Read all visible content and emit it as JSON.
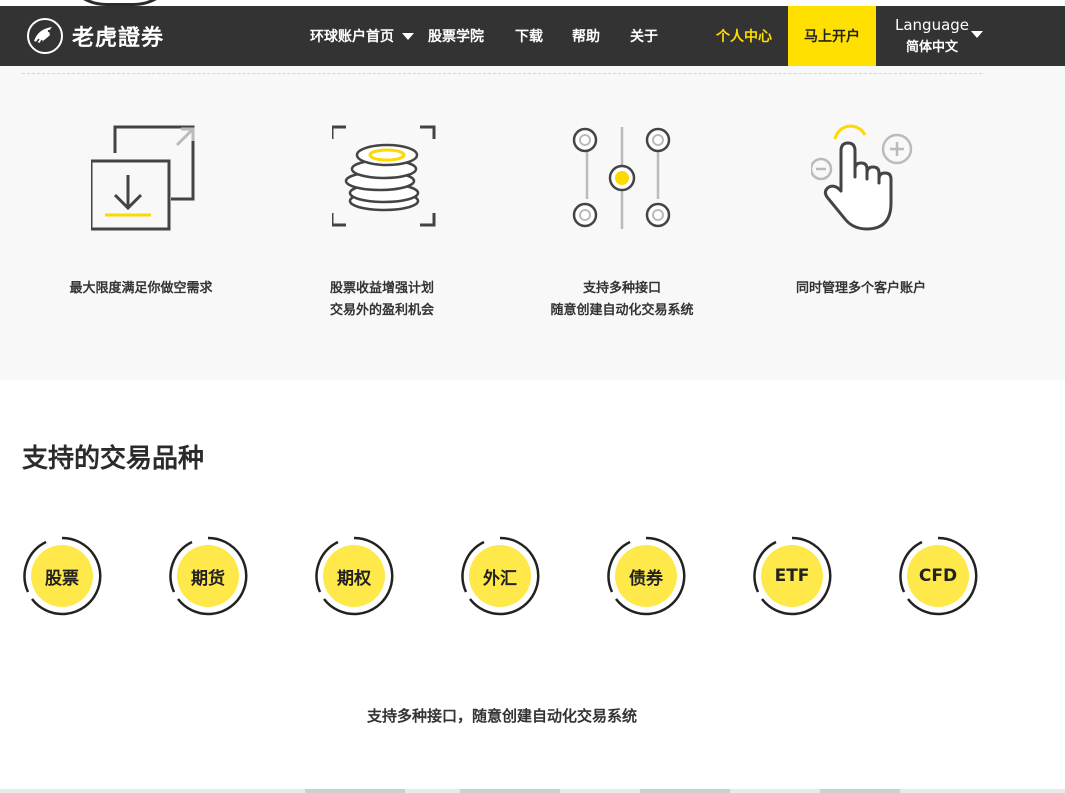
{
  "header": {
    "logo_text": "老虎證券",
    "nav": [
      "环球账户首页",
      "股票学院",
      "下载",
      "帮助",
      "关于"
    ],
    "user_center": "个人中心",
    "open_account": "马上开户",
    "language_title": "Language",
    "language_value": "简体中文"
  },
  "features": [
    {
      "icon": "download-frame-icon",
      "lines": [
        "最大限度满足你做空需求",
        ""
      ]
    },
    {
      "icon": "coins-stack-icon",
      "lines": [
        "股票收益增强计划",
        "交易外的盈利机会"
      ]
    },
    {
      "icon": "interfaces-icon",
      "lines": [
        "支持多种接口",
        "随意创建自动化交易系统"
      ]
    },
    {
      "icon": "hand-touch-icon",
      "lines": [
        "同时管理多个客户账户",
        ""
      ]
    }
  ],
  "varieties_title": "支持的交易品种",
  "varieties": [
    "股票",
    "期货",
    "期权",
    "外汇",
    "债券",
    "ETF",
    "CFD"
  ],
  "bottom_text": "支持多种接口，随意创建自动化交易系统",
  "colors": {
    "header_bg": "#333333",
    "accent": "#ffe000",
    "circle": "#ffe84a"
  }
}
